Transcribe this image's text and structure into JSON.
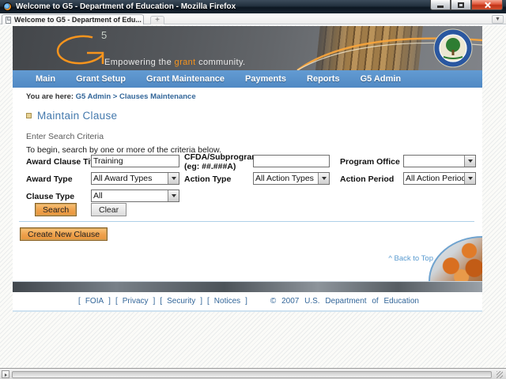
{
  "window": {
    "title": "Welcome to G5 - Department of Education - Mozilla Firefox",
    "tab_title": "Welcome to G5 - Department of Edu...",
    "new_tab_glyph": "+",
    "tab_list_glyph": "▼"
  },
  "header": {
    "logo_sup": "5",
    "tagline_prefix": "Empowering the ",
    "tagline_accent": "grant",
    "tagline_suffix": " community."
  },
  "nav": {
    "items": [
      "Main",
      "Grant Setup",
      "Grant Maintenance",
      "Payments",
      "Reports",
      "G5 Admin"
    ]
  },
  "breadcrumb": {
    "prefix": "You are here:",
    "path": "G5 Admin > Clauses Maintenance"
  },
  "main": {
    "page_title": "Maintain Clause",
    "section_heading": "Enter Search Criteria",
    "instructions": "To begin, search by one or more of the criteria below.",
    "back_to_top": "^ Back to Top"
  },
  "form": {
    "award_clause_title": {
      "label": "Award Clause Title",
      "value": "Training"
    },
    "cfda": {
      "label_line1": "CFDA/Subprogram",
      "label_line2": "(eg: ##.###A)",
      "value": ""
    },
    "program_office": {
      "label": "Program Office",
      "value": ""
    },
    "award_type": {
      "label": "Award Type",
      "value": "All Award Types"
    },
    "action_type": {
      "label": "Action Type",
      "value": "All Action Types"
    },
    "action_period": {
      "label": "Action Period",
      "value": "All Action Periods"
    },
    "clause_type": {
      "label": "Clause Type",
      "value": "All"
    },
    "buttons": {
      "search": "Search",
      "clear": "Clear",
      "create": "Create New Clause"
    }
  },
  "footer": {
    "bracket_l": "[",
    "bracket_r": "]",
    "links": [
      "FOIA",
      "Privacy",
      "Security",
      "Notices"
    ],
    "copyright": "© 2007 U.S. Department of Education"
  },
  "colors": {
    "nav_blue": "#5590cb",
    "link_blue": "#336699",
    "accent_orange": "#f7941d",
    "button_orange": "#eea04a",
    "title_blue": "#4479ad"
  }
}
